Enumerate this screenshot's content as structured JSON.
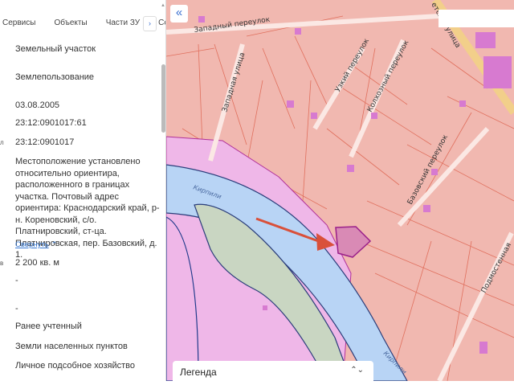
{
  "tabs": [
    "Сервисы",
    "Объекты",
    "Части ЗУ",
    "Соста"
  ],
  "tab_next": "›",
  "rows": {
    "type": "Земельный участок",
    "kind": "Землепользование",
    "date": "03.08.2005",
    "cad_number": "23:12:0901017:61",
    "quarter_label": "л",
    "quarter": "23:12:0901017",
    "address": "Местоположение установлено относительно ориентира, расположенного в границах участка. Почтовый адрес ориентира: Краснодарский край, р-н. Кореновский, с/о. Платнировский, ст-ца. Платнировская, пер. Базовский, д. 1.",
    "collapse": "Свернуть",
    "area_label": "в",
    "area": "2 200 кв. м",
    "dash1": "-",
    "dash2": "-",
    "status": "Ранее учтенный",
    "category": "Земли населенных пунктов",
    "use": "Личное подсобное хозяйство"
  },
  "map": {
    "collapse_icon": "«",
    "streets": [
      "Западный переулок",
      "Западная улица",
      "Узкий переулок",
      "Колхозный переулок",
      "Базовский переулок",
      "Подмостенная",
      "етская улица"
    ],
    "river": [
      "Кирпили",
      "Кирпили"
    ],
    "legend": "Легенда",
    "legend_icon": "⌃⌄",
    "colors": {
      "parcel": "#f1b8b0",
      "water": "#b8d4f5",
      "highlight": "#d98ab5",
      "arrow": "#d9503a"
    }
  }
}
